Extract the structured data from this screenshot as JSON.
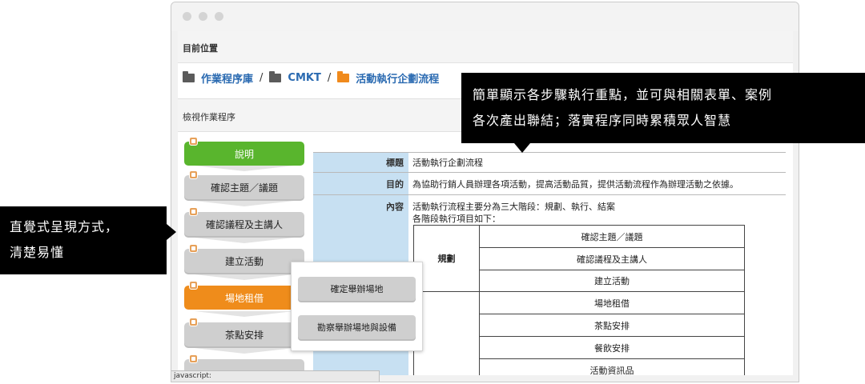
{
  "location": {
    "title": "目前位置"
  },
  "breadcrumb": [
    {
      "label": "作業程序庫",
      "icon": "folder-icon",
      "color": "#5b5b5b"
    },
    {
      "label": "CMKT",
      "icon": "folder-icon",
      "color": "#5b5b5b"
    },
    {
      "label": "活動執行企劃流程",
      "icon": "folder-icon",
      "color": "#f08a1c"
    }
  ],
  "breadcrumb_separator": "/",
  "view": {
    "title": "檢視作業程序"
  },
  "flow_steps": [
    {
      "label": "說明",
      "state": "active",
      "color": "#59b52d"
    },
    {
      "label": "確認主題／議題"
    },
    {
      "label": "確認議程及主講人"
    },
    {
      "label": "建立活動"
    },
    {
      "label": "場地租借",
      "state": "selected",
      "color": "#ef8c1b"
    },
    {
      "label": "茶點安排"
    }
  ],
  "popup_steps": [
    {
      "label": "確定舉辦場地"
    },
    {
      "label": "勘察舉辦場地與設備"
    }
  ],
  "info": {
    "title_label": "標題",
    "title_value": "活動執行企劃流程",
    "purpose_label": "目的",
    "purpose_value": "為協助行銷人員辦理各項活動，提高活動品質，提供活動流程作為辦理活動之依據。",
    "content_label": "內容",
    "content_line1": "活動執行流程主要分為三大階段：規劃、執行、結案",
    "content_line2": "各階段執行項目如下：",
    "phases": [
      {
        "phase": "規劃",
        "items": [
          "確認主題／議題",
          "確認議程及主講人",
          "建立活動"
        ]
      },
      {
        "phase": "",
        "items": [
          "場地租借",
          "茶點安排",
          "餐飲安排",
          "活動資訊品"
        ]
      }
    ]
  },
  "status_text": "javascript:",
  "callouts": {
    "left_line1": "直覺式呈現方式，",
    "left_line2": "清楚易懂",
    "right_line1": "簡單顯示各步驟執行重點，並可與相關表單、案例",
    "right_line2": "各次產出聯結；落實程序同時累積眾人智慧"
  },
  "colors": {
    "accent_blue": "#2a6ab1",
    "label_bg": "#c7e0f2",
    "callout_bg": "#000000"
  }
}
